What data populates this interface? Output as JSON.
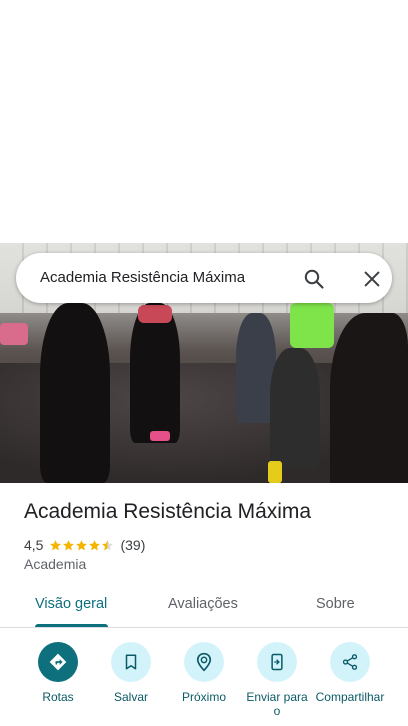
{
  "search": {
    "query": "Academia Resistência Máxima"
  },
  "place": {
    "title": "Academia Resistência Máxima",
    "rating": "4,5",
    "stars": 4.5,
    "reviews": "(39)",
    "category": "Academia"
  },
  "tabs": [
    {
      "label": "Visão geral",
      "active": true
    },
    {
      "label": "Avaliações",
      "active": false
    },
    {
      "label": "Sobre",
      "active": false
    }
  ],
  "actions": [
    {
      "label": "Rotas",
      "icon": "directions-icon"
    },
    {
      "label": "Salvar",
      "icon": "bookmark-icon"
    },
    {
      "label": "Próximo",
      "icon": "nearby-icon"
    },
    {
      "label": "Enviar para o",
      "icon": "send-to-phone-icon"
    },
    {
      "label": "Compartilhar",
      "icon": "share-icon"
    }
  ],
  "colors": {
    "accent": "#0e6f7d",
    "action_bg": "#d3f3fb",
    "star": "#f4b400"
  }
}
